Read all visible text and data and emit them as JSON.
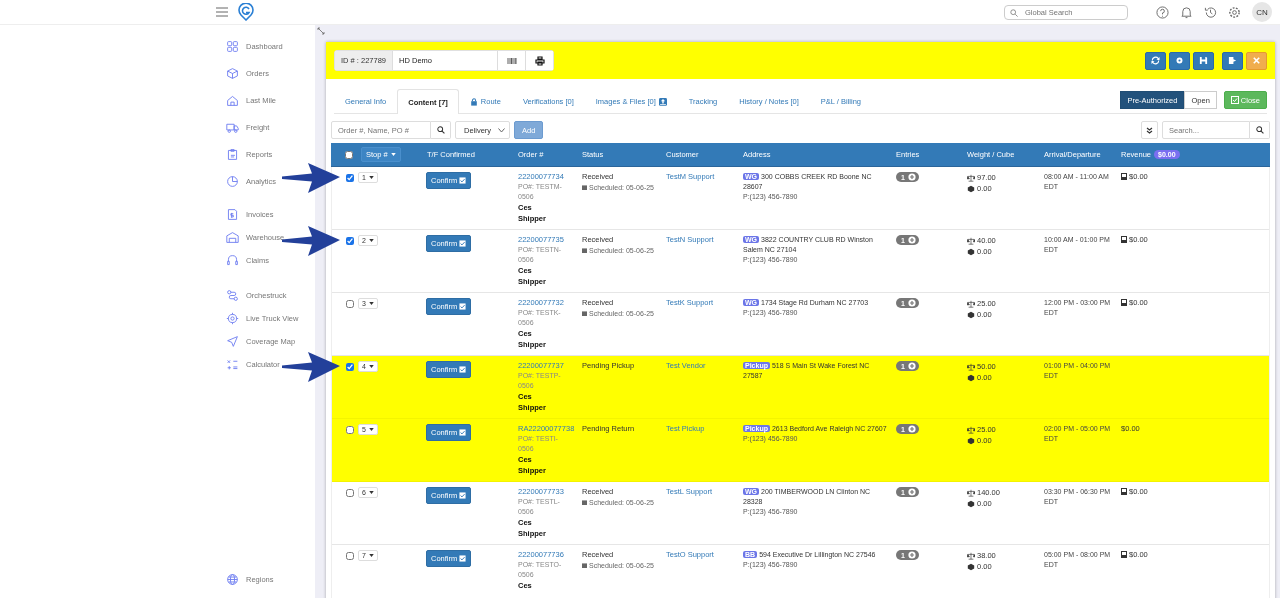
{
  "topbar": {
    "search_placeholder": "Global Search",
    "avatar": "CN"
  },
  "sidebar": {
    "groups": [
      [
        "Dashboard",
        "Orders",
        "Last Mile",
        "Freight",
        "Reports",
        "Analytics"
      ],
      [
        "Invoices",
        "Warehouse",
        "Claims"
      ],
      [
        "Orchestruck",
        "Live Truck View",
        "Coverage Map",
        "Calculator"
      ]
    ],
    "bottom": "Regions"
  },
  "header": {
    "id_label": "ID # : 227789",
    "name": "HD Demo"
  },
  "tabs": [
    {
      "label": "General Info",
      "selected": false,
      "kind": "plain"
    },
    {
      "label": "Content [7]",
      "selected": true,
      "kind": "plain"
    },
    {
      "label": "Route",
      "selected": false,
      "kind": "lock"
    },
    {
      "label": "Verifications [0]",
      "selected": false,
      "kind": "plain"
    },
    {
      "label": "Images & Files [0]",
      "selected": false,
      "kind": "upload"
    },
    {
      "label": "Tracking",
      "selected": false,
      "kind": "plain"
    },
    {
      "label": "History / Notes [0]",
      "selected": false,
      "kind": "plain"
    },
    {
      "label": "P&L / Billing",
      "selected": false,
      "kind": "plain"
    }
  ],
  "status_toggle": [
    {
      "label": "Pre-Authorized",
      "selected": true
    },
    {
      "label": "Open",
      "selected": false
    }
  ],
  "close_button": "Close",
  "toolbar": {
    "order_placeholder": "Order #, Name, PO #",
    "type": "Delivery",
    "add": "Add",
    "search_placeholder": "Search..."
  },
  "table": {
    "columns": [
      "Stop #",
      "T/F Confirmed",
      "Order #",
      "Status",
      "Customer",
      "Address",
      "Entries",
      "Weight / Cube",
      "Arrival/Departure",
      "Revenue"
    ],
    "revenue_total": "$0.00",
    "select_all_checked": false,
    "rows": [
      {
        "checked": true,
        "pointer": true,
        "highlighted": false,
        "stop": "1",
        "confirm": "Confirm",
        "order": "22200077734",
        "po": "PO#: TESTM-0506",
        "shipper": "Ces Shipper",
        "status": "Received",
        "scheduled": "Scheduled: 05-06-25",
        "customer": "TestM Support",
        "tag": "WG",
        "address": "300 COBBS CREEK RD Boone NC 28607",
        "phone": "P:(123) 456-7890",
        "entries": "1",
        "weight": "97.00",
        "cube": "0.00",
        "time": "08:00 AM - 11:00 AM",
        "tz": "EDT",
        "revenue": "$0.00",
        "revenue_icon": true
      },
      {
        "checked": true,
        "pointer": true,
        "highlighted": false,
        "stop": "2",
        "confirm": "Confirm",
        "order": "22200077735",
        "po": "PO#: TESTN-0506",
        "shipper": "Ces Shipper",
        "status": "Received",
        "scheduled": "Scheduled: 05-06-25",
        "customer": "TestN Support",
        "tag": "WG",
        "address": "3822 COUNTRY CLUB RD Winston Salem NC 27104",
        "phone": "P:(123) 456-7890",
        "entries": "1",
        "weight": "40.00",
        "cube": "0.00",
        "time": "10:00 AM - 01:00 PM",
        "tz": "EDT",
        "revenue": "$0.00",
        "revenue_icon": true
      },
      {
        "checked": false,
        "pointer": false,
        "highlighted": false,
        "stop": "3",
        "confirm": "Confirm",
        "order": "22200077732",
        "po": "PO#: TESTK-0506",
        "shipper": "Ces Shipper",
        "status": "Received",
        "scheduled": "Scheduled: 05-06-25",
        "customer": "TestK Support",
        "tag": "WG",
        "address": "1734 Stage Rd Durham NC 27703",
        "phone": "P:(123) 456-7890",
        "entries": "1",
        "weight": "25.00",
        "cube": "0.00",
        "time": "12:00 PM - 03:00 PM",
        "tz": "EDT",
        "revenue": "$0.00",
        "revenue_icon": true
      },
      {
        "checked": true,
        "pointer": true,
        "highlighted": true,
        "stop": "4",
        "confirm": "Confirm",
        "order": "22200077737",
        "po": "PO#: TESTP-0506",
        "shipper": "Ces Shipper",
        "status": "Pending Pickup",
        "customer": "Test Vendor",
        "tag": "Pickup",
        "address": "518 S Main St Wake Forest NC 27587",
        "entries": "1",
        "weight": "50.00",
        "cube": "0.00",
        "time": "01:00 PM - 04:00 PM",
        "tz": "EDT"
      },
      {
        "checked": false,
        "pointer": false,
        "highlighted": true,
        "stop": "5",
        "confirm": "Confirm",
        "order": "RA22200077738",
        "po": "PO#: TESTI-0506",
        "shipper": "Ces Shipper",
        "status": "Pending Return",
        "customer": "Test Pickup",
        "tag": "Pickup",
        "address": "2613 Bedford Ave Raleigh NC 27607",
        "phone": "P:(123) 456-7890",
        "entries": "1",
        "weight": "25.00",
        "cube": "0.00",
        "time": "02:00 PM - 05:00 PM",
        "tz": "EDT",
        "revenue": "$0.00",
        "revenue_icon": false
      },
      {
        "checked": false,
        "pointer": false,
        "highlighted": false,
        "stop": "6",
        "confirm": "Confirm",
        "order": "22200077733",
        "po": "PO#: TESTL-0506",
        "shipper": "Ces Shipper",
        "status": "Received",
        "scheduled": "Scheduled: 05-06-25",
        "customer": "TestL Support",
        "tag": "WG",
        "address": "200 TIMBERWOOD LN Clinton NC 28328",
        "phone": "P:(123) 456-7890",
        "entries": "1",
        "weight": "140.00",
        "cube": "0.00",
        "time": "03:30 PM - 06:30 PM",
        "tz": "EDT",
        "revenue": "$0.00",
        "revenue_icon": true
      },
      {
        "checked": false,
        "pointer": false,
        "highlighted": false,
        "stop": "7",
        "confirm": "Confirm",
        "order": "22200077736",
        "po": "PO#: TESTO-0506",
        "shipper": "Ces",
        "status": "Received",
        "scheduled": "Scheduled: 05-06-25",
        "customer": "TestO Support",
        "tag": "BB",
        "address": "594 Executive Dr Lillington NC 27546",
        "phone": "P:(123) 456-7890",
        "entries": "1",
        "weight": "38.00",
        "cube": "0.00",
        "time": "05:00 PM - 08:00 PM",
        "tz": "EDT",
        "revenue": "$0.00",
        "revenue_icon": true
      }
    ]
  }
}
